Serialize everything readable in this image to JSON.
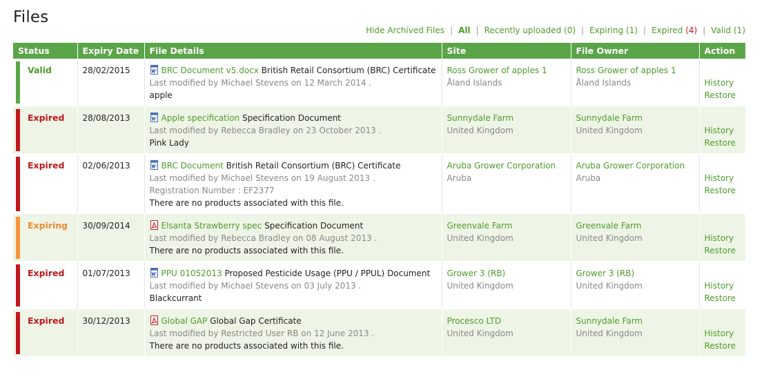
{
  "page_title": "Files",
  "filters": {
    "hide_archived": "Hide Archived Files",
    "all": "All",
    "recent_label": "Recently uploaded",
    "recent_count": "(0)",
    "expiring_label": "Expiring",
    "expiring_count": "(1)",
    "expired_label": "Expired",
    "expired_count": "(4)",
    "valid_label": "Valid",
    "valid_count": "(1)"
  },
  "columns": {
    "status": "Status",
    "expiry": "Expiry Date",
    "details": "File Details",
    "site": "Site",
    "owner": "File Owner",
    "action": "Action"
  },
  "actions": {
    "history": "History",
    "restore": "Restore"
  },
  "rows": [
    {
      "status": "Valid",
      "expiry": "28/02/2015",
      "icon": "word-doc-icon",
      "file_link": "BRC Document v5.docx",
      "file_type": "British Retail Consortium (BRC) Certificate",
      "modified": "Last modified by Michael Stevens on 12 March 2014 .",
      "extra": "",
      "products": "apple",
      "site_name": "Ross Grower of apples 1",
      "site_country": "Åland Islands",
      "owner_name": "Ross Grower of apples 1",
      "owner_country": "Åland Islands"
    },
    {
      "status": "Expired",
      "expiry": "28/08/2013",
      "icon": "word-doc-icon",
      "file_link": "Apple specification",
      "file_type": "Specification Document",
      "modified": "Last modified by Rebecca Bradley on 23 October 2013 .",
      "extra": "",
      "products": "Pink Lady",
      "site_name": "Sunnydale Farm",
      "site_country": "United Kingdom",
      "owner_name": "Sunnydale Farm",
      "owner_country": "United Kingdom"
    },
    {
      "status": "Expired",
      "expiry": "02/06/2013",
      "icon": "word-doc-icon",
      "file_link": "BRC Document",
      "file_type": "British Retail Consortium (BRC) Certificate",
      "modified": "Last modified by Michael Stevens on 19 August 2013 .",
      "extra": "Registration Number : EF2377",
      "products": "There are no products associated with this file.",
      "site_name": "Aruba Grower Corporation",
      "site_country": "Aruba",
      "owner_name": "Aruba Grower Corporation",
      "owner_country": "Aruba"
    },
    {
      "status": "Expiring",
      "expiry": "30/09/2014",
      "icon": "pdf-icon",
      "file_link": "Elsanta Strawberry spec",
      "file_type": "Specification Document",
      "modified": "Last modified by Rebecca Bradley on 08 August 2013 .",
      "extra": "",
      "products": "There are no products associated with this file.",
      "site_name": "Greenvale Farm",
      "site_country": "United Kingdom",
      "owner_name": "Greenvale Farm",
      "owner_country": "United Kingdom"
    },
    {
      "status": "Expired",
      "expiry": "01/07/2013",
      "icon": "word-doc-icon",
      "file_link": "PPU 01052013",
      "file_type": "Proposed Pesticide Usage (PPU / PPUL) Document",
      "modified": "Last modified by Michael Stevens on 03 July 2013 .",
      "extra": "",
      "products": "Blackcurrant",
      "site_name": "Grower 3 (RB)",
      "site_country": "United Kingdom",
      "owner_name": "Grower 3 (RB)",
      "owner_country": "United Kingdom"
    },
    {
      "status": "Expired",
      "expiry": "30/12/2013",
      "icon": "pdf-icon",
      "file_link": "Global GAP",
      "file_type": "Global Gap Certificate",
      "modified": "Last modified by Restricted User RB on 12 June 2013 .",
      "extra": "",
      "products": "There are no products associated with this file.",
      "site_name": "Procesco LTD",
      "site_country": "United Kingdom",
      "owner_name": "Sunnydale Farm",
      "owner_country": "United Kingdom"
    }
  ]
}
